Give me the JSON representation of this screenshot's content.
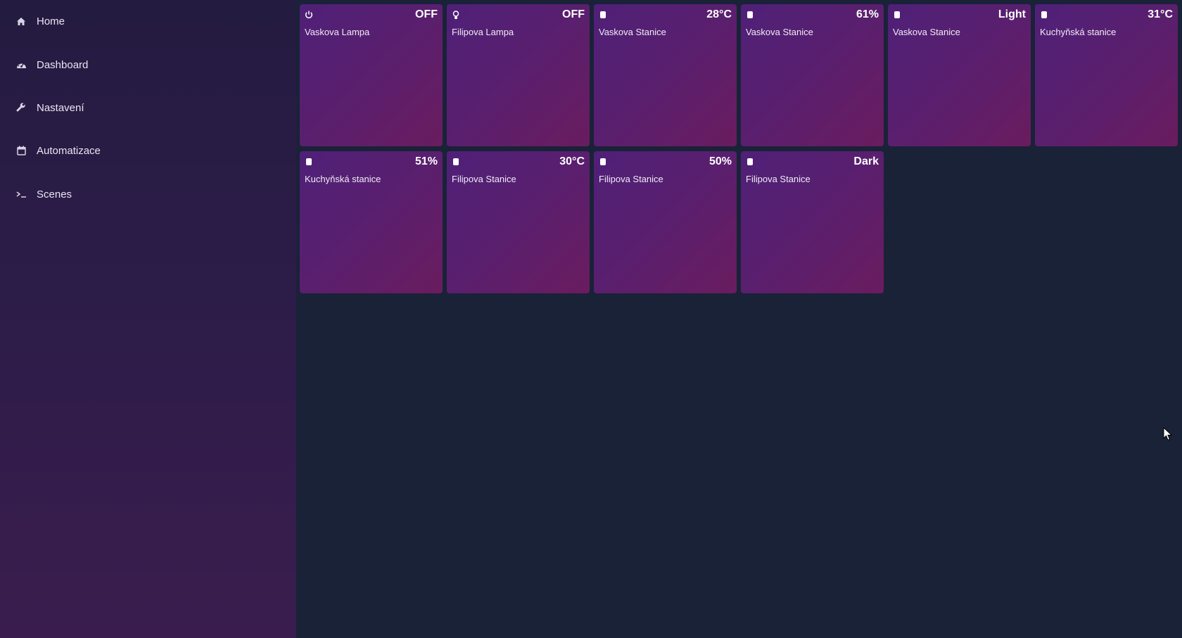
{
  "sidebar": {
    "items": [
      {
        "label": "Home",
        "icon": "home-icon"
      },
      {
        "label": "Dashboard",
        "icon": "dashboard-icon"
      },
      {
        "label": "Nastavení",
        "icon": "wrench-icon"
      },
      {
        "label": "Automatizace",
        "icon": "calendar-icon"
      },
      {
        "label": "Scenes",
        "icon": "terminal-icon"
      }
    ]
  },
  "tiles": [
    {
      "name": "Vaskova Lampa",
      "value": "OFF",
      "icon": "power-icon"
    },
    {
      "name": "Filipova Lampa",
      "value": "OFF",
      "icon": "lightbulb-icon"
    },
    {
      "name": "Vaskova Stanice",
      "value": "28°C",
      "icon": "chip-icon"
    },
    {
      "name": "Vaskova Stanice",
      "value": "61%",
      "icon": "chip-icon"
    },
    {
      "name": "Vaskova Stanice",
      "value": "Light",
      "icon": "chip-icon"
    },
    {
      "name": "Kuchyňská stanice",
      "value": "31°C",
      "icon": "chip-icon"
    },
    {
      "name": "Kuchyňská stanice",
      "value": "51%",
      "icon": "chip-icon"
    },
    {
      "name": "Filipova Stanice",
      "value": "30°C",
      "icon": "chip-icon"
    },
    {
      "name": "Filipova Stanice",
      "value": "50%",
      "icon": "chip-icon"
    },
    {
      "name": "Filipova Stanice",
      "value": "Dark",
      "icon": "chip-icon"
    }
  ],
  "colors": {
    "background": "#1a2238",
    "sidebar_top": "#241b40",
    "sidebar_bottom": "#3a1d4e",
    "tile_start": "#4f2078",
    "tile_end": "#6a1c5e"
  }
}
